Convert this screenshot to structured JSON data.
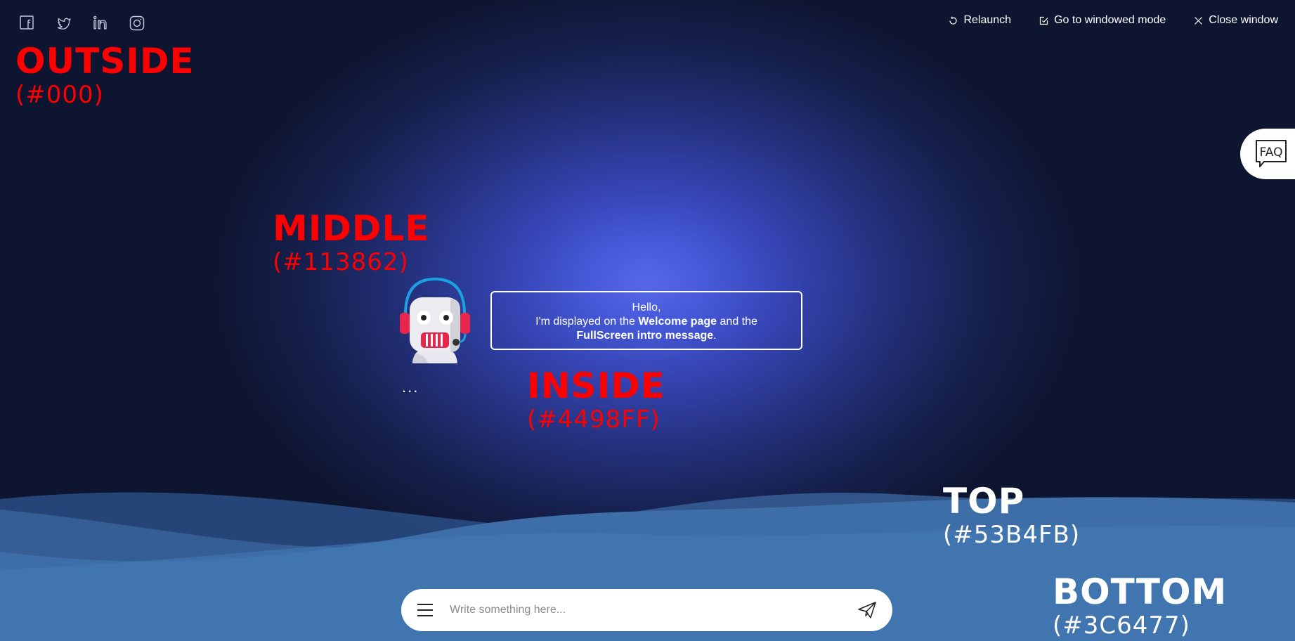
{
  "social": {
    "icons": [
      "facebook-icon",
      "twitter-icon",
      "linkedin-icon",
      "instagram-icon"
    ]
  },
  "topnav": {
    "relaunch_label": "Relaunch",
    "windowed_label": "Go to windowed mode",
    "close_label": "Close window"
  },
  "legend": {
    "outside": {
      "name": "OUTSIDE",
      "code": "(#000)"
    },
    "middle": {
      "name": "MIDDLE",
      "code": "(#113862)"
    },
    "inside": {
      "name": "INSIDE",
      "code": "(#4498FF)"
    },
    "top": {
      "name": "TOP",
      "code": "(#53B4FB)"
    },
    "bottom": {
      "name": "BOTTOM",
      "code": "(#3C6477)"
    }
  },
  "faq": {
    "label": "FAQ"
  },
  "bot": {
    "typing_indicator": "...",
    "message": {
      "line1": "Hello,",
      "line2_prefix": "I'm displayed on the ",
      "line2_bold": "Welcome page",
      "line2_suffix": " and the",
      "line3_bold": "FullScreen intro message",
      "line3_suffix": "."
    }
  },
  "composer": {
    "placeholder": "Write something here..."
  },
  "colors": {
    "label_red": "#ff0000",
    "wave_top": "#53B4FB",
    "wave_bottom": "#3C6477",
    "inside": "#4498FF",
    "middle": "#113862",
    "outside": "#000"
  }
}
